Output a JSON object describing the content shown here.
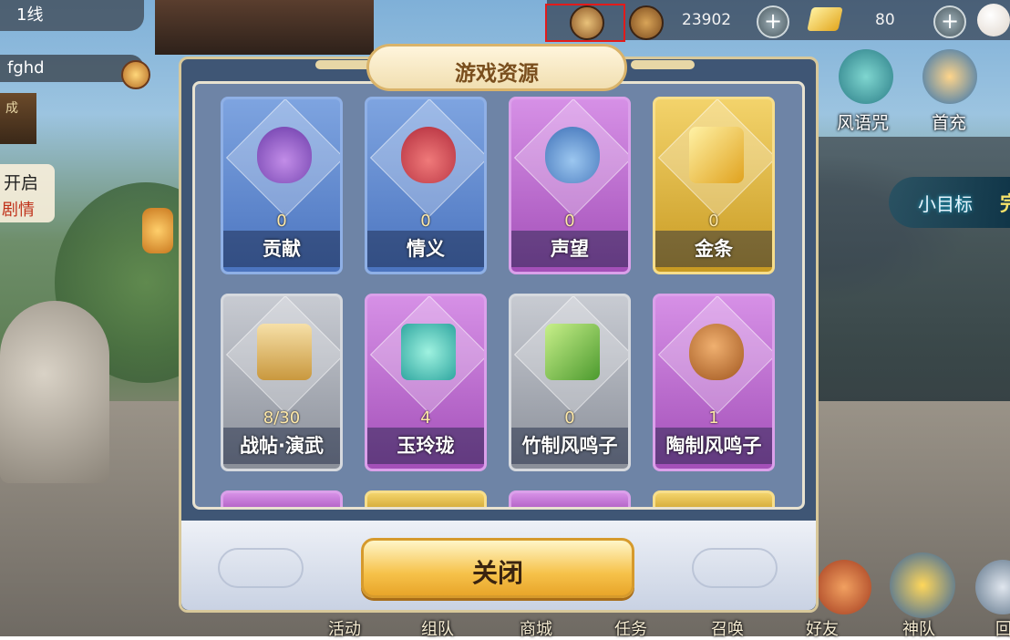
{
  "hud": {
    "line": "1线",
    "player_name": "fghd",
    "side_tab": "成",
    "quest_open": "开启",
    "quest_type": "剧情"
  },
  "currency": {
    "copper": "23902",
    "gold": "80",
    "add_symbol": "+"
  },
  "side_menu": {
    "fengyu": "风语咒",
    "shouchong": "首充"
  },
  "target": {
    "label": "小目标",
    "suffix": "完"
  },
  "dialog": {
    "title": "游戏资源",
    "close_label": "关闭",
    "items": [
      {
        "name": "贡献",
        "count": "0",
        "icon": "contribution-bag-icon",
        "style": "blue"
      },
      {
        "name": "情义",
        "count": "0",
        "icon": "friendship-bag-icon",
        "style": "blue"
      },
      {
        "name": "声望",
        "count": "0",
        "icon": "reputation-bag-icon",
        "style": "purple"
      },
      {
        "name": "金条",
        "count": "0",
        "icon": "gold-bar-icon",
        "style": "gold"
      },
      {
        "name": "战帖·演武",
        "count": "8/30",
        "icon": "challenge-scroll-icon",
        "style": "gray"
      },
      {
        "name": "玉玲珑",
        "count": "4",
        "icon": "jade-ornament-icon",
        "style": "purple"
      },
      {
        "name": "竹制风鸣子",
        "count": "0",
        "icon": "bamboo-flute-icon",
        "style": "gray"
      },
      {
        "name": "陶制风鸣子",
        "count": "1",
        "icon": "ceramic-ocarina-icon",
        "style": "purple"
      }
    ]
  },
  "bottom_nav": {
    "activity": "活动",
    "team": "组队",
    "shop": "商城",
    "task": "任务",
    "summon": "召唤",
    "friend": "好友",
    "divine_team": "神队",
    "extra": "回"
  },
  "colors": {
    "card_blue": "#5a84cc",
    "card_purple": "#b861cc",
    "card_gold": "#d9ad33",
    "card_gray": "#a3a7af",
    "highlight_red": "#e21b1b",
    "button_gold": "#f6c24a"
  }
}
